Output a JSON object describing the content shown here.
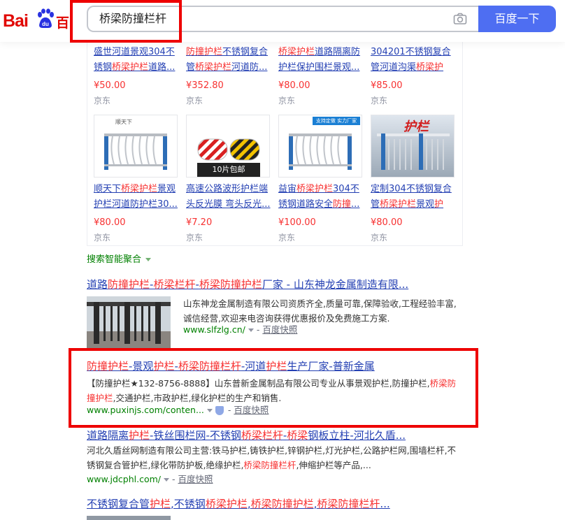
{
  "header": {
    "logo_text": "Bai",
    "logo_cn": "百度",
    "search_value": "桥梁防撞栏杆",
    "search_button": "百度一下"
  },
  "products": [
    {
      "title": "盛世河道景观304不锈钢桥梁护栏道路...",
      "price": "¥50.00",
      "shop": "京东"
    },
    {
      "title": "防撞护栏不锈钢复合管桥梁护栏河道防...",
      "price": "¥352.80",
      "shop": "京东"
    },
    {
      "title": "桥梁护栏道路隔离防护栏保护围栏景观...",
      "price": "¥80.00",
      "shop": "京东"
    },
    {
      "title": "304201不锈钢复合管河道沟渠桥梁护栏...",
      "price": "¥85.00",
      "shop": "京东"
    },
    {
      "title": "顺天下桥梁护栏景观护栏河道防护栏30...",
      "price": "¥80.00",
      "shop": "京东",
      "img_label": "顺天下"
    },
    {
      "title": "高速公路波形护栏端头反光膜 弯头反光...",
      "price": "¥7.20",
      "shop": "京东",
      "img_label": "10片包邮"
    },
    {
      "title": "益宙桥梁护栏304不锈钢道路安全防撞...",
      "price": "¥100.00",
      "shop": "京东",
      "img_label": "支持定做 实力厂家"
    },
    {
      "title": "定制304不锈钢复合管桥梁护栏景观护栏...",
      "price": "¥80.00",
      "shop": "京东",
      "img_label": "护栏"
    }
  ],
  "aggregation": "搜索智能聚合",
  "results": [
    {
      "title": "道路防撞护栏-桥梁栏杆-桥梁防撞护栏厂家 - 山东神龙金属制造有限...",
      "desc": "山东神龙金属制造有限公司资质齐全,质量可靠,保障验收,工程经验丰富,诚信经营,欢迎来电咨询获得优惠报价及免费施工方案.",
      "url": "www.slfzlg.cn/",
      "snapshot": "百度快照"
    },
    {
      "title": "防撞护栏-景观护栏-桥梁防撞栏杆-河道护栏生产厂家-普新金属",
      "desc": "【防撞护栏★132-8756-8888】山东普新金属制品有限公司专业从事景观护栏,防撞护栏,桥梁防撞护栏,交通护栏,市政护栏,绿化护栏的生产和销售.",
      "url": "www.puxinjs.com/conten...",
      "snapshot": "百度快照"
    },
    {
      "title": "道路隔离护栏-铁丝围栏网-不锈钢桥梁栏杆-桥梁钢板立柱-河北久盾...",
      "desc": "河北久盾丝网制造有限公司主营:铁马护栏,铸铁护栏,锌钢护栏,灯光护栏,公路护栏网,围墙栏杆,不锈钢复合管护栏,绿化带防护板,绝缘护栏,桥梁防撞栏杆,伸缩护栏等产品,...",
      "url": "www.jdcphl.com/",
      "snapshot": "百度快照"
    },
    {
      "title": "不锈钢复合管护栏,不锈钢桥梁护栏,桥梁防撞护栏,桥梁防撞栏杆..."
    }
  ]
}
